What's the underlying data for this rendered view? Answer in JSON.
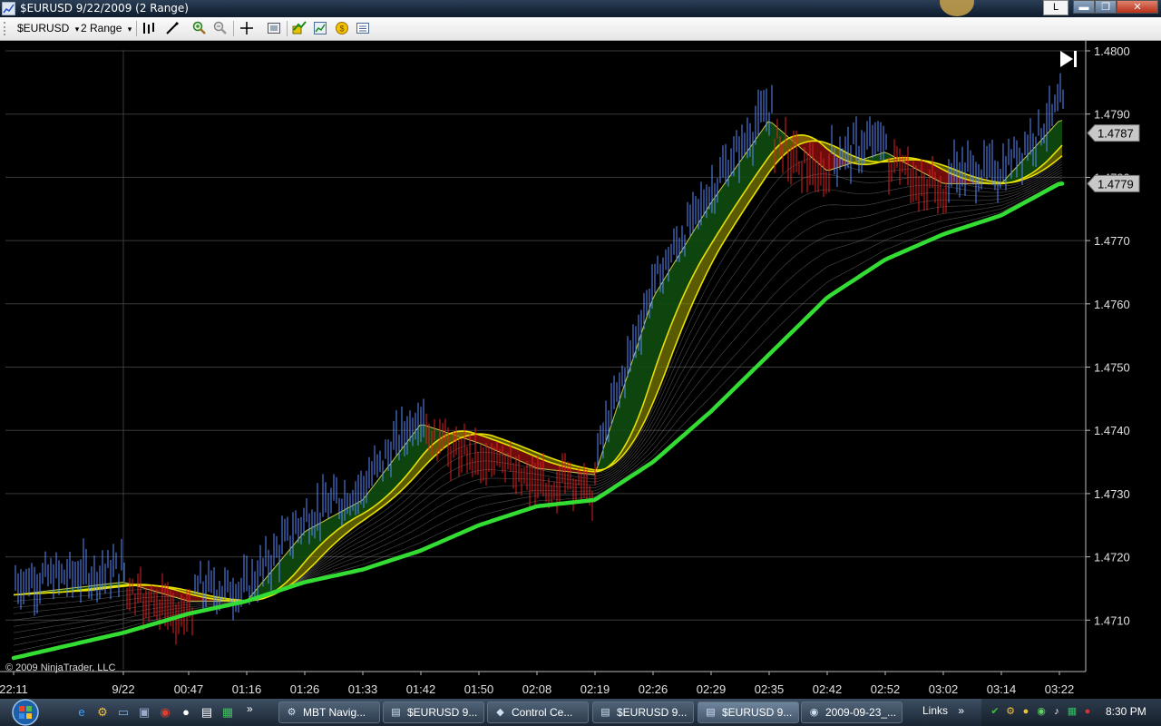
{
  "window": {
    "title": "$EURUSD  9/22/2009 (2 Range)",
    "l_button": "L",
    "minimize_glyph": "▬",
    "maximize_glyph": "❐",
    "close_glyph": "✕",
    "icon": "chart-app-icon"
  },
  "toolbar": {
    "instrument": "$EURUSD",
    "period": "2 Range",
    "dropdown_glyph": "▾",
    "icons": [
      "bar-type-icon",
      "drawing-tools-icon",
      "zoom-in-icon",
      "zoom-out-icon",
      "crosshair-icon",
      "properties-icon",
      "indicators-icon",
      "strategies-icon",
      "data-box-icon",
      "chart-trader-icon"
    ]
  },
  "chart": {
    "copyright": "© 2009 NinjaTrader, LLC",
    "go_to_end_glyph": "▶|",
    "price_labels": [
      "1.4800",
      "1.4790",
      "1.4780",
      "1.4770",
      "1.4760",
      "1.4750",
      "1.4740",
      "1.4730",
      "1.4720",
      "1.4710"
    ],
    "last_price_tag": "1.4787",
    "ma_price_tag": "1.4779",
    "time_labels": [
      "22:11",
      "9/22",
      "00:47",
      "01:16",
      "01:26",
      "01:33",
      "01:42",
      "01:50",
      "02:08",
      "02:19",
      "02:26",
      "02:29",
      "02:35",
      "02:42",
      "02:52",
      "03:02",
      "03:14",
      "03:22"
    ],
    "colors": {
      "background": "#000000",
      "grid": "#3a3a3a",
      "up_tick": "#5a8cff",
      "down_tick": "#e02020",
      "fast_ribbon_up": "#0f4d0f",
      "fast_ribbon_down": "#7a0d0d",
      "yellow_band": "#e8e000",
      "slow_ma": "#33dd33",
      "ribbon_lines": "#8a8a8a"
    }
  },
  "chart_data": {
    "type": "line",
    "title": "$EURUSD 9/22/2009 (2 Range)",
    "xlabel": "",
    "ylabel": "",
    "ylim": [
      1.4705,
      1.48
    ],
    "grid": true,
    "series": [
      {
        "x": [
          "22:11",
          "9/22",
          "00:47",
          "01:16",
          "01:26",
          "01:33",
          "01:42",
          "01:50",
          "02:08",
          "02:19",
          "02:26",
          "02:29",
          "02:35",
          "02:42",
          "02:52",
          "03:02",
          "03:14",
          "03:22"
        ],
        "values": [
          1.4714,
          1.4716,
          1.4713,
          1.4713,
          1.4724,
          1.4729,
          1.4741,
          1.4738,
          1.4734,
          1.4733,
          1.4761,
          1.4776,
          1.4789,
          1.4781,
          1.4784,
          1.4779,
          1.4779,
          1.4789
        ]
      },
      {
        "x": [
          "22:11",
          "9/22",
          "00:47",
          "01:16",
          "01:26",
          "01:33",
          "01:42",
          "01:50",
          "02:08",
          "02:19",
          "02:26",
          "02:29",
          "02:35",
          "02:42",
          "02:52",
          "03:02",
          "03:14",
          "03:22"
        ],
        "values": [
          1.4704,
          1.4708,
          1.4711,
          1.4713,
          1.4716,
          1.4718,
          1.4721,
          1.4725,
          1.4728,
          1.4729,
          1.4735,
          1.4743,
          1.4752,
          1.4761,
          1.4767,
          1.4771,
          1.4774,
          1.4779
        ]
      }
    ]
  },
  "taskbar": {
    "quicklaunch_icons": [
      "ie-icon",
      "mbt-icon",
      "desktop-icon",
      "window-switch-icon",
      "chrome-icon",
      "panda-icon",
      "notepad-icon",
      "ninjatrader-icon"
    ],
    "overflow": "»",
    "buttons": [
      {
        "label": "MBT Navig...",
        "icon": "mbt-icon"
      },
      {
        "label": "$EURUSD  9...",
        "icon": "chart-app-icon"
      },
      {
        "label": "Control Ce...",
        "icon": "control-center-icon"
      },
      {
        "label": "$EURUSD  9...",
        "icon": "chart-app-icon"
      },
      {
        "label": "$EURUSD  9...",
        "icon": "chart-app-icon"
      },
      {
        "label": "2009-09-23_...",
        "icon": "chrome-icon"
      }
    ],
    "links": "Links",
    "links_overflow": "»",
    "tray_icons": [
      "shield-icon",
      "network-icon",
      "messenger-icon",
      "security-icon",
      "volume-icon",
      "network-status-icon",
      "language-icon"
    ],
    "clock": "8:30 PM"
  }
}
